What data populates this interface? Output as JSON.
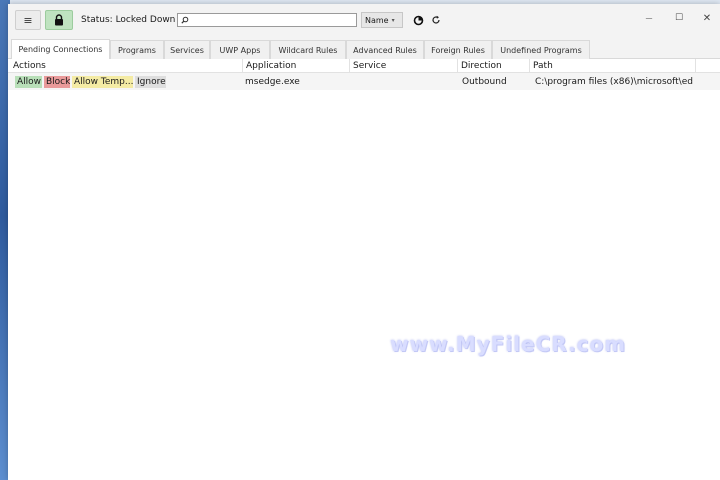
{
  "toolbar": {
    "menu_icon": "hamburger-icon",
    "lock_icon": "lock-icon",
    "status_text": "Status: Locked Down",
    "search_icon": "search-icon",
    "search_value": "",
    "sort_value": "Name",
    "sort_chevron": "▾",
    "refresh_all_icon": "sync-icon",
    "refresh_icon": "refresh-icon",
    "lock_color": "#bfe3c0"
  },
  "window_controls": {
    "minimize": "—",
    "maximize": "☐",
    "close": "✕"
  },
  "tabs": [
    {
      "label": "Pending Connections"
    },
    {
      "label": "Programs"
    },
    {
      "label": "Services"
    },
    {
      "label": "UWP Apps"
    },
    {
      "label": "Wildcard Rules"
    },
    {
      "label": "Advanced Rules"
    },
    {
      "label": "Foreign Rules"
    },
    {
      "label": "Undefined Programs"
    }
  ],
  "table": {
    "columns": [
      "Actions",
      "Application",
      "Service",
      "Direction",
      "Path"
    ],
    "rows": [
      {
        "actions": [
          "Allow",
          "Block",
          "Allow Temp...",
          "Ignore"
        ],
        "application": "msedge.exe",
        "service": "",
        "direction": "Outbound",
        "path": "C:\\program files (x86)\\microsoft\\ed"
      }
    ]
  },
  "colors": {
    "allow": "#b8dfb8",
    "block": "#e99a9a",
    "allow_temp": "#f4eba4",
    "ignore": "#dedede"
  },
  "watermark": "www.MyFileCR.com"
}
